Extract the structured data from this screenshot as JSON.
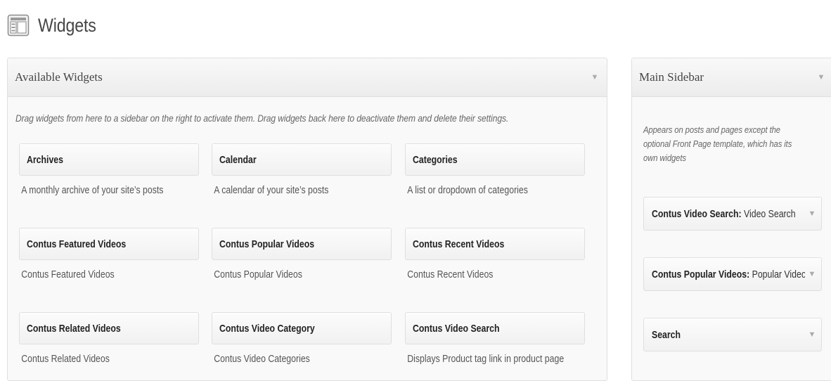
{
  "page": {
    "title": "Widgets",
    "icon": "widgets-icon"
  },
  "available": {
    "title": "Available Widgets",
    "description": "Drag widgets from here to a sidebar on the right to activate them. Drag widgets back here to deactivate them and delete their settings.",
    "widgets": [
      {
        "name": "Archives",
        "desc": "A monthly archive of your site’s posts"
      },
      {
        "name": "Calendar",
        "desc": "A calendar of your site’s posts"
      },
      {
        "name": "Categories",
        "desc": "A list or dropdown of categories"
      },
      {
        "name": "Contus Featured Videos",
        "desc": "Contus Featured Videos"
      },
      {
        "name": "Contus Popular Videos",
        "desc": "Contus Popular Videos"
      },
      {
        "name": "Contus Recent Videos",
        "desc": "Contus Recent Videos"
      },
      {
        "name": "Contus Related Videos",
        "desc": "Contus Related Videos"
      },
      {
        "name": "Contus Video Category",
        "desc": "Contus Video Categories"
      },
      {
        "name": "Contus Video Search",
        "desc": "Displays Product tag link in product page"
      }
    ]
  },
  "sidebar": {
    "title": "Main Sidebar",
    "description": "Appears on posts and pages except the optional Front Page template, which has its own widgets",
    "widgets": [
      {
        "name": "Contus Video Search:",
        "subtitle": "Video Search"
      },
      {
        "name": "Contus Popular Videos:",
        "subtitle": "Popular Videos"
      },
      {
        "name": "Search",
        "subtitle": ""
      }
    ]
  },
  "colors": {
    "border": "#dfdfdf",
    "panel_bg": "#f9f9f9",
    "text": "#464646"
  }
}
